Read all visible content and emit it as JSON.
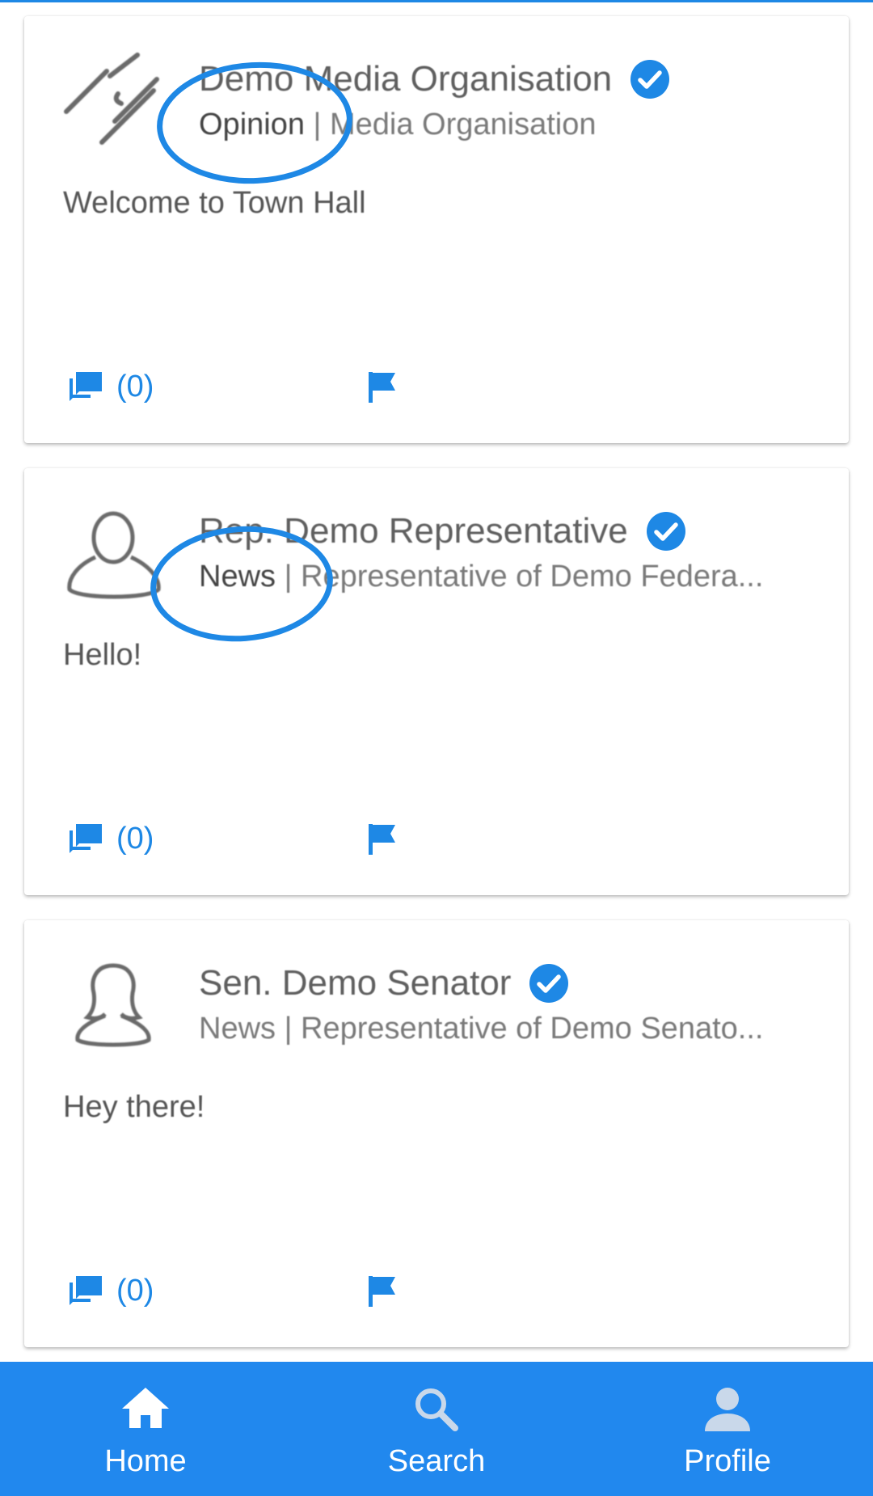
{
  "colors": {
    "accent": "#1e88e5",
    "nav_background": "#2188ee",
    "annotation": "#1e88e5"
  },
  "posts": [
    {
      "avatar_icon": "chain-link-icon",
      "name": "Demo Media Organisation",
      "verified": true,
      "category": "Opinion",
      "subtitle_rest": " | Media Organisation",
      "text": "Welcome to Town Hall",
      "comment_count": "(0)",
      "highlighted": true
    },
    {
      "avatar_icon": "male-person-icon",
      "name": "Rep. Demo Representative",
      "verified": true,
      "category": "News",
      "subtitle_rest": " | Representative of Demo Federa...",
      "text": "Hello!",
      "comment_count": "(0)",
      "highlighted": true
    },
    {
      "avatar_icon": "female-person-icon",
      "name": "Sen. Demo Senator",
      "verified": true,
      "category": "News",
      "subtitle_rest": " | Representative of Demo Senato...",
      "text": "Hey there!",
      "comment_count": "(0)",
      "highlighted": false
    }
  ],
  "bottom_nav": {
    "items": [
      {
        "label": "Home",
        "icon": "home-icon",
        "active": true
      },
      {
        "label": "Search",
        "icon": "search-icon",
        "active": false
      },
      {
        "label": "Profile",
        "icon": "profile-icon",
        "active": false
      }
    ]
  }
}
